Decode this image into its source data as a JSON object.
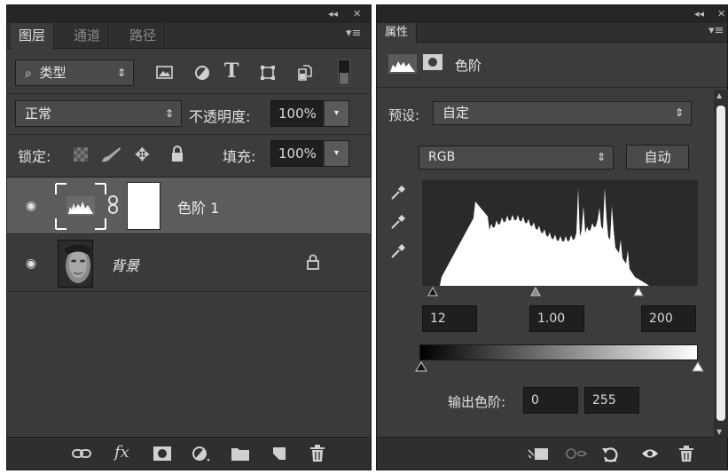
{
  "layers_panel": {
    "topbar": {
      "collapse": "◂◂",
      "close": "✕"
    },
    "tabs": [
      {
        "label": "图层"
      },
      {
        "label": "通道"
      },
      {
        "label": "路径"
      }
    ],
    "menu_icon": "▾≡",
    "filter": {
      "search_glyph": "⌕",
      "value": "类型",
      "arrow": "⇕"
    },
    "blend": {
      "value": "正常",
      "arrow": "⇕"
    },
    "opacity": {
      "label": "不透明度:",
      "value": "100%",
      "arrow": "▾"
    },
    "lock": {
      "label": "锁定:"
    },
    "fill": {
      "label": "填充:",
      "value": "100%",
      "arrow": "▾"
    },
    "layers": [
      {
        "name": "色阶 1",
        "selected": true
      },
      {
        "name": "背景",
        "locked": true
      }
    ],
    "bottom_icons": [
      "link-icon",
      "fx-icon",
      "mask-icon",
      "adjustment-icon",
      "folder-icon",
      "new-layer-icon",
      "trash-icon"
    ],
    "fx_label": "fx"
  },
  "properties_panel": {
    "topbar": {
      "collapse": "◂◂",
      "close": "✕"
    },
    "tab": {
      "label": "属性"
    },
    "menu_icon": "▾≡",
    "title": "色阶",
    "preset": {
      "label": "预设:",
      "value": "自定",
      "arrow": "⇕"
    },
    "channel": {
      "value": "RGB",
      "arrow": "⇕"
    },
    "auto_label": "自动",
    "input_levels": {
      "black": "12",
      "gamma": "1.00",
      "white": "200"
    },
    "output": {
      "label": "输出色阶:",
      "black": "0",
      "white": "255"
    },
    "colors": {
      "panel": "#3c3c3c",
      "histogram_bg": "#2a2a2a",
      "histogram_fill": "#ffffff"
    },
    "bottom_icons": [
      "clip-to-layer-icon",
      "view-previous-icon",
      "reset-icon",
      "visibility-icon",
      "trash-icon"
    ]
  }
}
